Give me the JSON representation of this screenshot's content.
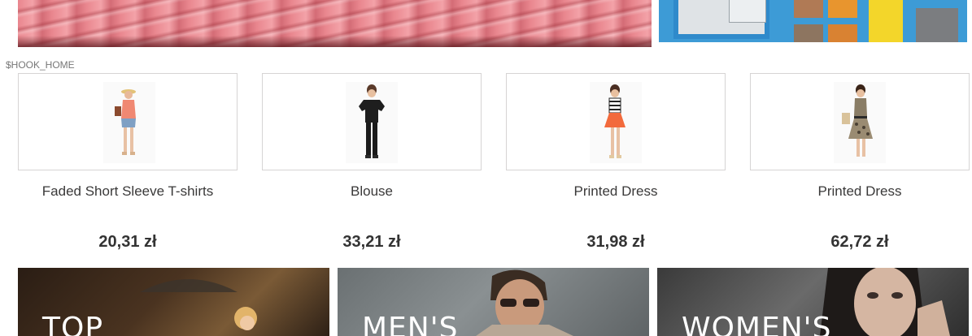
{
  "hook_label": "$HOOK_HOME",
  "products": [
    {
      "name": "Faded Short Sleeve T-shirts",
      "price": "20,31 zł"
    },
    {
      "name": "Blouse",
      "price": "33,21 zł"
    },
    {
      "name": "Printed Dress",
      "price": "31,98 zł"
    },
    {
      "name": "Printed Dress",
      "price": "62,72 zł"
    }
  ],
  "categories": [
    {
      "label": "TOP"
    },
    {
      "label": "MEN'S"
    },
    {
      "label": "WOMEN'S"
    }
  ],
  "colors": {
    "card_border": "#d6d4d4",
    "text": "#333333"
  }
}
